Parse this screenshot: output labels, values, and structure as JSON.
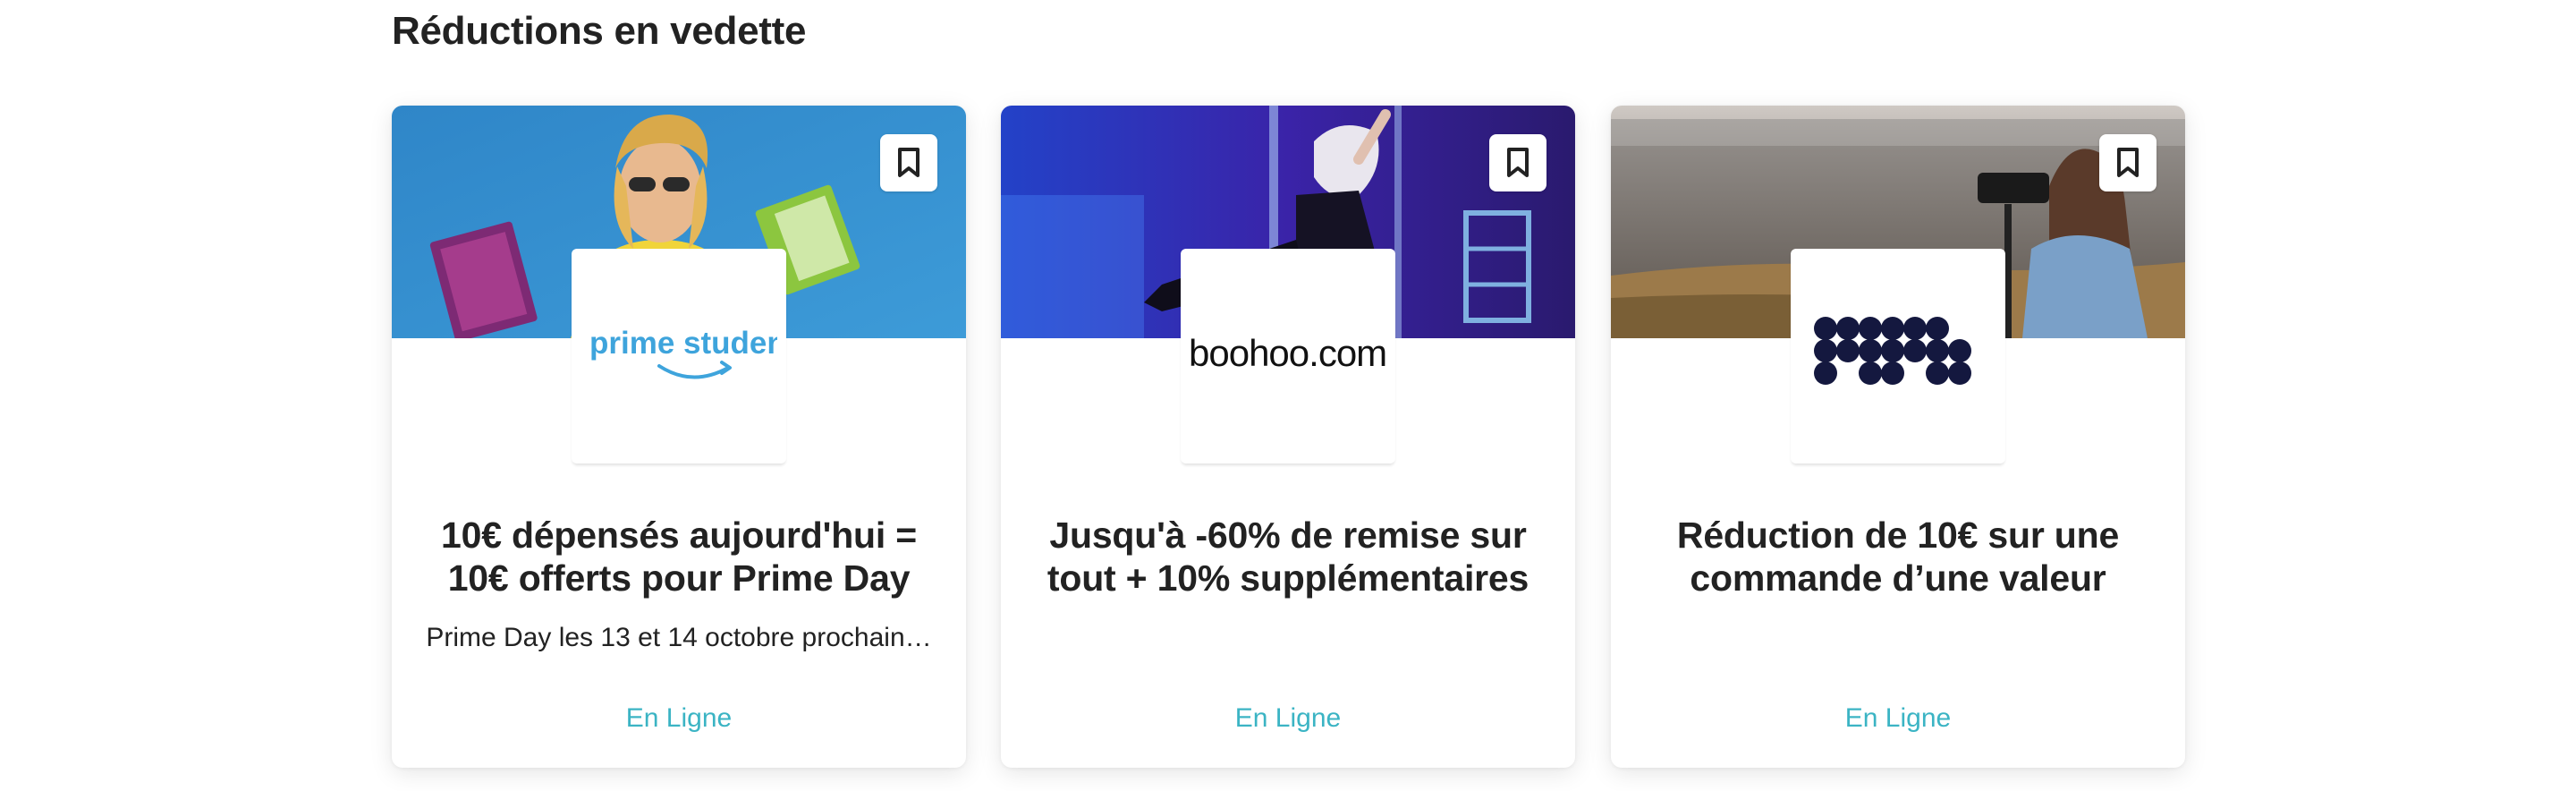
{
  "section": {
    "title": "Réductions en vedette"
  },
  "colors": {
    "link": "#3bb4c4",
    "text": "#222222",
    "card_bg": "#ffffff"
  },
  "deals": [
    {
      "brand_logo_text": "prime student",
      "image_icon": "reading-woman-photo",
      "title": "10€ dépensés aujourd'hui = 10€ offerts pour Prime Day",
      "description": "Prime Day les 13 et 14 octobre prochain…",
      "link_label": "En Ligne"
    },
    {
      "brand_logo_text": "boohoo.com",
      "image_icon": "performer-stage-photo",
      "title": "Jusqu'à -60% de remise sur tout + 10% supplémentaires",
      "description": "",
      "link_label": "En Ligne"
    },
    {
      "brand_logo_text": "",
      "image_icon": "photographer-lake-photo",
      "title": "Réduction de 10€ sur une commande d’une valeur",
      "description": "",
      "link_label": "En Ligne"
    }
  ]
}
